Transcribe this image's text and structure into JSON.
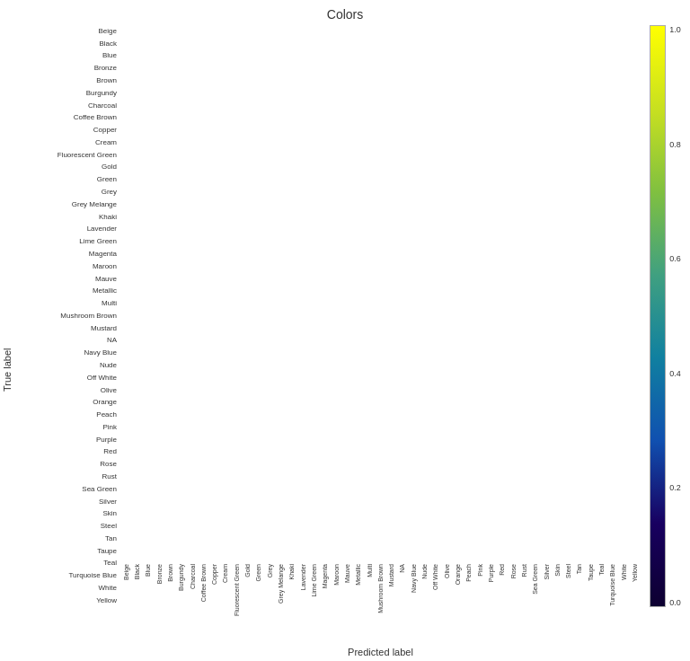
{
  "title": "Colors",
  "xlabel": "Predicted label",
  "ylabel": "True label",
  "colorbar_labels": [
    "1.0",
    "0.8",
    "0.6",
    "0.4",
    "0.2",
    "0.0"
  ],
  "row_labels": [
    "Beige",
    "Black",
    "Blue",
    "Bronze",
    "Brown",
    "Burgundy",
    "Charcoal",
    "Coffee Brown",
    "Copper",
    "Cream",
    "Fluorescent Green",
    "Gold",
    "Green",
    "Grey",
    "Grey Melange",
    "Khaki",
    "Lavender",
    "Lime Green",
    "Magenta",
    "Maroon",
    "Mauve",
    "Metallic",
    "Multi",
    "Mushroom Brown",
    "Mustard",
    "NA",
    "Navy Blue",
    "Nude",
    "Off White",
    "Olive",
    "Orange",
    "Peach",
    "Pink",
    "Purple",
    "Red",
    "Rose",
    "Rust",
    "Sea Green",
    "Silver",
    "Skin",
    "Steel",
    "Tan",
    "Taupe",
    "Teal",
    "Turquoise Blue",
    "White",
    "Yellow"
  ],
  "col_labels": [
    "Beige",
    "Black",
    "Blue",
    "Bronze",
    "Brown",
    "Burgundy",
    "Charcoal",
    "Coffee Brown",
    "Copper",
    "Cream",
    "Fluorescent Green",
    "Gold",
    "Green",
    "Grey",
    "Grey Melange",
    "Khaki",
    "Lavender",
    "Lime Green",
    "Magenta",
    "Maroon",
    "Mauve",
    "Metallic",
    "Multi",
    "Mushroom Brown",
    "Mustard",
    "NA",
    "Navy Blue",
    "Nude",
    "Off White",
    "Olive",
    "Orange",
    "Peach",
    "Pink",
    "Purple",
    "Red",
    "Rose",
    "Rust",
    "Sea Green",
    "Silver",
    "Skin",
    "Steel",
    "Tan",
    "Taupe",
    "Teal",
    "Turquoise Blue",
    "White",
    "Yellow"
  ],
  "accent_color": "#1a9688"
}
